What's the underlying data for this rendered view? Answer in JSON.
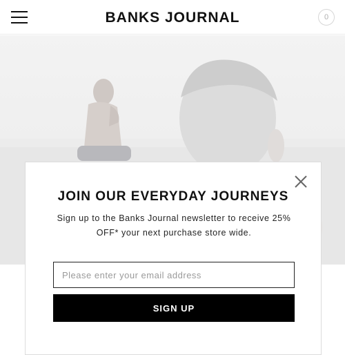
{
  "header": {
    "brand": "BANKS JOURNAL",
    "cart_count": "0",
    "menu_icon": "hamburger-menu-icon"
  },
  "popup": {
    "title": "JOIN OUR EVERYDAY JOURNEYS",
    "description": "Sign up to the Banks Journal newsletter to receive 25% OFF* your next purchase store wide.",
    "email_value": "",
    "email_placeholder": "Please enter your email address",
    "submit_label": "SIGN UP",
    "close_icon": "close-icon"
  }
}
